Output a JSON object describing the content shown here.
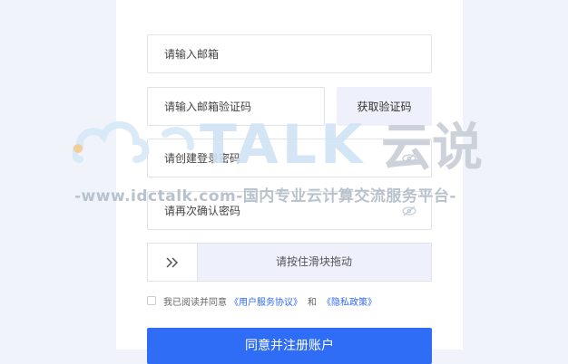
{
  "form": {
    "email_placeholder": "请输入邮箱",
    "code_placeholder": "请输入邮箱验证码",
    "get_code_label": "获取验证码",
    "password_placeholder": "请创建登录密码",
    "confirm_password_placeholder": "请再次确认密码",
    "slider_text": "请按住滑块拖动",
    "agree_text": "我已阅读并同意",
    "terms_link": "《用户服务协议》",
    "and_text": "和",
    "privacy_link": "《隐私政策》",
    "submit_label": "同意并注册账户"
  },
  "watermark": {
    "brand": "TALK",
    "brand_cn": "云说",
    "tagline": "-www.idctalk.com-国内专业云计算交流服务平台-"
  },
  "colors": {
    "accent": "#2f6df6",
    "link": "#2f6bf5",
    "background": "#f0f3fa"
  }
}
